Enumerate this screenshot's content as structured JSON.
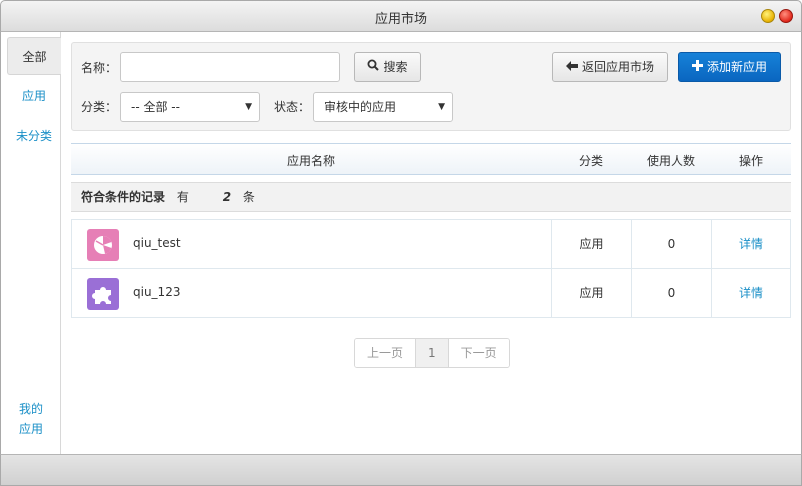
{
  "window": {
    "title": "应用市场"
  },
  "sidebar": {
    "items": [
      {
        "label": "全部",
        "active": true
      },
      {
        "label": "应用",
        "active": false
      },
      {
        "label": "未分类",
        "active": false
      }
    ],
    "my_apps": [
      "我的",
      "应用"
    ]
  },
  "filter": {
    "name_label": "名称：",
    "name_value": "",
    "search_button": "搜索",
    "category_label": "分类：",
    "category_value": "-- 全部 --",
    "status_label": "状态：",
    "status_value": "审核中的应用",
    "back_button": "返回应用市场",
    "add_button": "添加新应用"
  },
  "table": {
    "columns": [
      "应用名称",
      "分类",
      "使用人数",
      "操作"
    ],
    "summary": {
      "prefix": "符合条件的记录",
      "has": "有",
      "count": "2",
      "unit": "条"
    },
    "rows": [
      {
        "name": "qiu_test",
        "category": "应用",
        "users": "0",
        "action": "详情",
        "icon": "pie-chart-icon",
        "icon_color": "#e67fb6"
      },
      {
        "name": "qiu_123",
        "category": "应用",
        "users": "0",
        "action": "详情",
        "icon": "puzzle-piece-icon",
        "icon_color": "#9a6fd6"
      }
    ]
  },
  "pagination": {
    "prev": "上一页",
    "current": "1",
    "next": "下一页"
  },
  "colors": {
    "accent": "#1a8fc7",
    "primary_button": "#0a66c0"
  }
}
